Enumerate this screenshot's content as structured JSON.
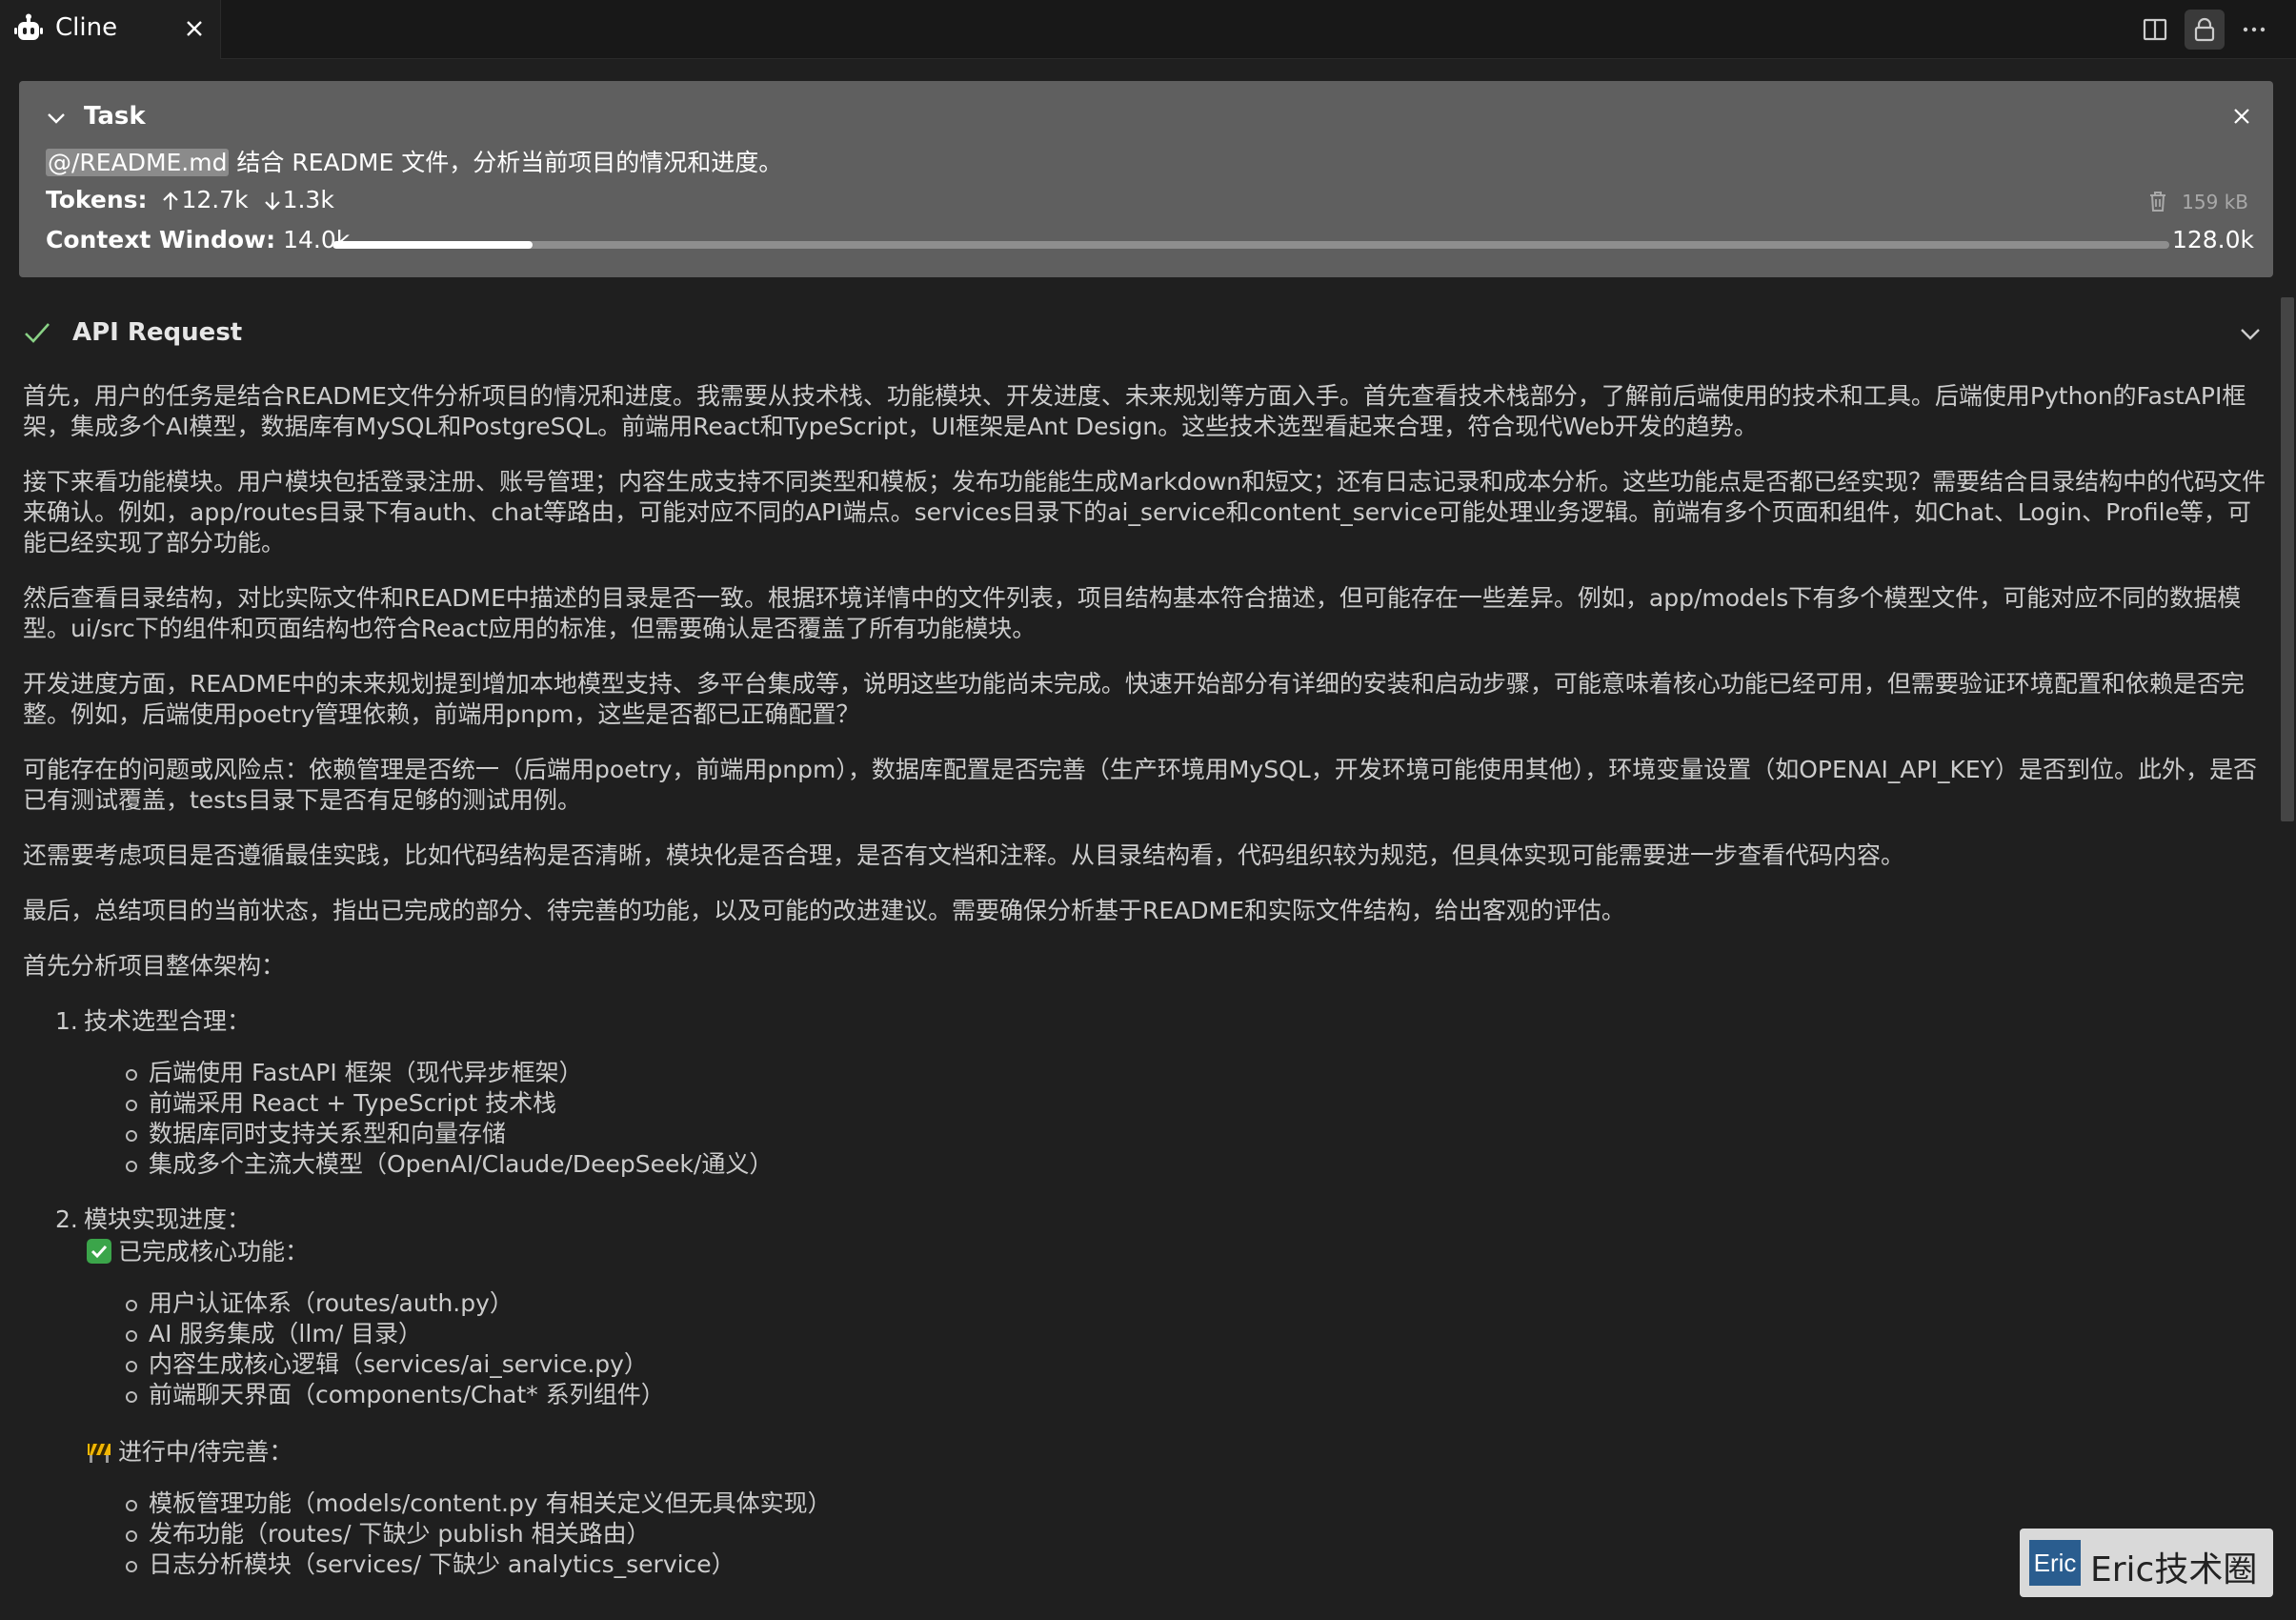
{
  "tab": {
    "label": "Cline"
  },
  "task": {
    "title": "Task",
    "mention": "@/README.md",
    "text": " 结合 README 文件，分析当前项目的情况和进度。",
    "tokens_label": "Tokens:",
    "tokens_in": "12.7k",
    "tokens_out": "1.3k",
    "size": "159 kB",
    "context_label": "Context Window:",
    "context_used": "14.0k",
    "context_max": "128.0k",
    "context_fraction": 0.109
  },
  "api_request": {
    "title": "API Request"
  },
  "content": {
    "paragraphs": [
      "首先，用户的任务是结合README文件分析项目的情况和进度。我需要从技术栈、功能模块、开发进度、未来规划等方面入手。首先查看技术栈部分，了解前后端使用的技术和工具。后端使用Python的FastAPI框架，集成多个AI模型，数据库有MySQL和PostgreSQL。前端用React和TypeScript，UI框架是Ant Design。这些技术选型看起来合理，符合现代Web开发的趋势。",
      "接下来看功能模块。用户模块包括登录注册、账号管理；内容生成支持不同类型和模板；发布功能能生成Markdown和短文；还有日志记录和成本分析。这些功能点是否都已经实现？需要结合目录结构中的代码文件来确认。例如，app/routes目录下有auth、chat等路由，可能对应不同的API端点。services目录下的ai_service和content_service可能处理业务逻辑。前端有多个页面和组件，如Chat、Login、Profile等，可能已经实现了部分功能。",
      "然后查看目录结构，对比实际文件和README中描述的目录是否一致。根据环境详情中的文件列表，项目结构基本符合描述，但可能存在一些差异。例如，app/models下有多个模型文件，可能对应不同的数据模型。ui/src下的组件和页面结构也符合React应用的标准，但需要确认是否覆盖了所有功能模块。",
      "开发进度方面，README中的未来规划提到增加本地模型支持、多平台集成等，说明这些功能尚未完成。快速开始部分有详细的安装和启动步骤，可能意味着核心功能已经可用，但需要验证环境配置和依赖是否完整。例如，后端使用poetry管理依赖，前端用pnpm，这些是否都已正确配置？",
      "可能存在的问题或风险点：依赖管理是否统一（后端用poetry，前端用pnpm），数据库配置是否完善（生产环境用MySQL，开发环境可能使用其他），环境变量设置（如OPENAI_API_KEY）是否到位。此外，是否已有测试覆盖，tests目录下是否有足够的测试用例。",
      "还需要考虑项目是否遵循最佳实践，比如代码结构是否清晰，模块化是否合理，是否有文档和注释。从目录结构看，代码组织较为规范，但具体实现可能需要进一步查看代码内容。",
      "最后，总结项目的当前状态，指出已完成的部分、待完善的功能，以及可能的改进建议。需要确保分析基于README和实际文件结构，给出客观的评估。",
      "首先分析项目整体架构："
    ],
    "list1_num": "1.",
    "list1_head": "技术选型合理：",
    "list1_items": [
      "后端使用 FastAPI 框架（现代异步框架）",
      "前端采用 React + TypeScript 技术栈",
      "数据库同时支持关系型和向量存储",
      "集成多个主流大模型（OpenAI/Claude/DeepSeek/通义）"
    ],
    "list2_num": "2.",
    "list2_head": "模块实现进度：",
    "done_head": "已完成核心功能：",
    "done_items": [
      "用户认证体系（routes/auth.py）",
      "AI 服务集成（llm/ 目录）",
      "内容生成核心逻辑（services/ai_service.py）",
      "前端聊天界面（components/Chat* 系列组件）"
    ],
    "wip_head": "进行中/待完善：",
    "wip_items": [
      "模板管理功能（models/content.py 有相关定义但无具体实现）",
      "发布功能（routes/ 下缺少 publish 相关路由）",
      "日志分析模块（services/ 下缺少 analytics_service）"
    ]
  },
  "watermark": {
    "logo": "Eric",
    "text": "Eric技术圈"
  },
  "icons": [
    "robot-icon",
    "close-icon",
    "split-editor-icon",
    "lock-icon",
    "more-icon",
    "chevron-down-icon",
    "trash-icon",
    "arrow-up-icon",
    "arrow-down-icon",
    "check-icon",
    "check-mark-emoji-icon",
    "construction-emoji-icon"
  ],
  "colors": {
    "background": "#1f1f1f",
    "task_card": "#5f5f5f",
    "check": "#89d185",
    "text": "#cccccc"
  }
}
